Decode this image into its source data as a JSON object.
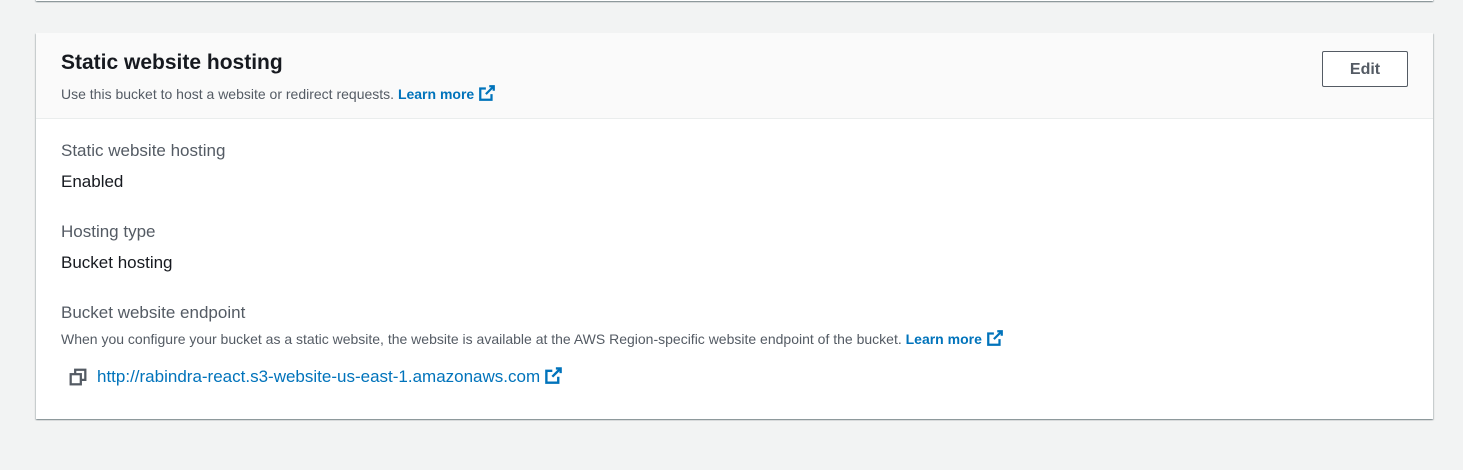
{
  "panel": {
    "title": "Static website hosting",
    "description": "Use this bucket to host a website or redirect requests.",
    "learn_more": "Learn more",
    "edit_label": "Edit"
  },
  "fields": {
    "hosting_label": "Static website hosting",
    "hosting_value": "Enabled",
    "type_label": "Hosting type",
    "type_value": "Bucket hosting",
    "endpoint_label": "Bucket website endpoint",
    "endpoint_description": "When you configure your bucket as a static website, the website is available at the AWS Region-specific website endpoint of the bucket.",
    "endpoint_learn_more": "Learn more",
    "endpoint_url": "http://rabindra-react.s3-website-us-east-1.amazonaws.com"
  },
  "icons": {
    "external": "external-link-icon",
    "copy": "copy-icon"
  },
  "colors": {
    "link": "#0073bb",
    "text": "#16191f",
    "secondary_text": "#545b64",
    "background": "#f2f3f3"
  }
}
